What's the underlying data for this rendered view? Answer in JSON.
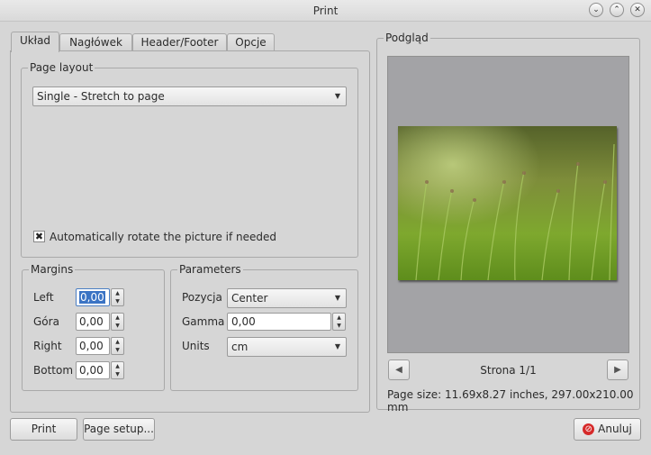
{
  "window": {
    "title": "Print"
  },
  "tabs": [
    {
      "label": "Układ",
      "active": true
    },
    {
      "label": "Nagłówek"
    },
    {
      "label": "Header/Footer"
    },
    {
      "label": "Opcje"
    }
  ],
  "page_layout": {
    "title": "Page layout",
    "selected": "Single - Stretch to page",
    "auto_rotate_label": "Automatically rotate the picture if needed",
    "auto_rotate_checked": true
  },
  "margins": {
    "title": "Margins",
    "fields": [
      {
        "label": "Left",
        "value": "0,00"
      },
      {
        "label": "Góra",
        "value": "0,00"
      },
      {
        "label": "Right",
        "value": "0,00"
      },
      {
        "label": "Bottom",
        "value": "0,00"
      }
    ]
  },
  "parameters": {
    "title": "Parameters",
    "pozycja_label": "Pozycja",
    "pozycja_value": "Center",
    "gamma_label": "Gamma",
    "gamma_value": "0,00",
    "units_label": "Units",
    "units_value": "cm"
  },
  "preview": {
    "title": "Podgląd",
    "page_indicator": "Strona 1/1",
    "page_size": "Page size: 11.69x8.27 inches, 297.00x210.00 mm"
  },
  "buttons": {
    "print": "Print",
    "page_setup": "Page setup...",
    "cancel": "Anuluj"
  },
  "icons": {
    "minimize": "chevron-down-icon",
    "maximize": "chevron-up-icon",
    "close": "close-icon",
    "cancel": "cancel-icon",
    "prev": "arrow-left-icon",
    "next": "arrow-right-icon"
  },
  "colors": {
    "cancel_icon": "#d62a2a",
    "focus": "#3a73c4"
  }
}
